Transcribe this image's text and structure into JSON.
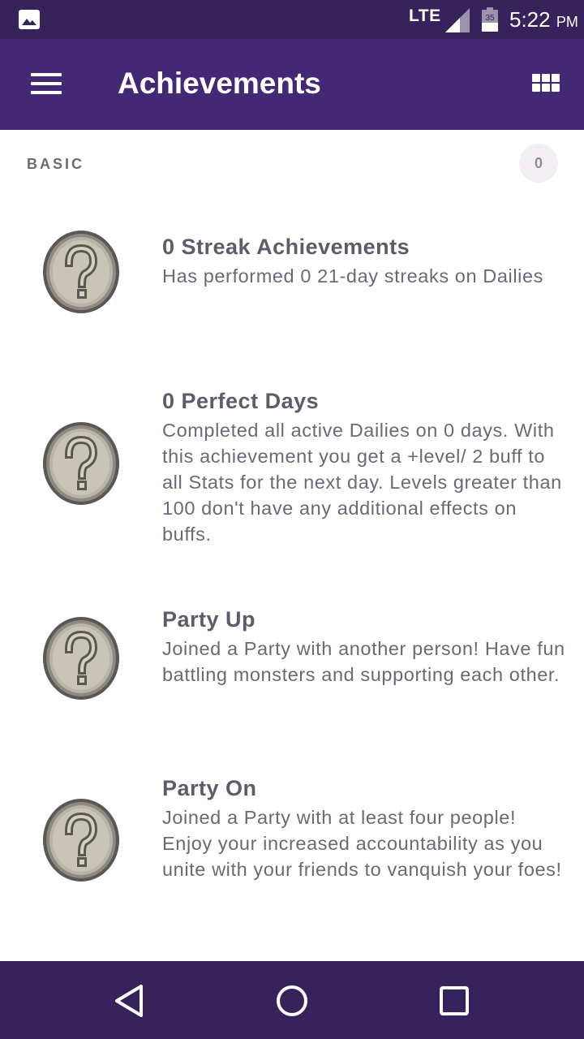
{
  "status_bar": {
    "network": "LTE",
    "battery_level": "35",
    "time": "5:22",
    "time_suffix": "PM"
  },
  "app_bar": {
    "title": "Achievements"
  },
  "section": {
    "label": "BASIC",
    "count": "0"
  },
  "achievements": [
    {
      "title": "0 Streak Achievements",
      "description": "Has performed 0 21-day streaks on Dailies"
    },
    {
      "title": "0 Perfect Days",
      "description": "Completed all active Dailies on 0 days. With this achievement you get a +level/ 2 buff to all Stats for the next day. Levels greater than 100 don't have any additional effects on buffs."
    },
    {
      "title": "Party Up",
      "description": "Joined a Party with another person! Have fun battling monsters and supporting each other."
    },
    {
      "title": "Party On",
      "description": "Joined a Party with at least four people! Enjoy your increased accountability as you unite with your friends to vanquish your foes!"
    }
  ],
  "icons": {
    "gallery": "image-icon",
    "signal": "cell-signal-icon",
    "battery": "battery-icon",
    "menu": "hamburger-menu-icon",
    "grid": "grid-view-icon",
    "badge": "locked-achievement-question-icon",
    "back": "back-triangle-icon",
    "home": "home-circle-icon",
    "recents": "recents-square-icon"
  },
  "colors": {
    "status_bar": "#36235c",
    "app_bar": "#432874",
    "nav_bar": "#36235c",
    "title_text": "#5f5b6b"
  }
}
